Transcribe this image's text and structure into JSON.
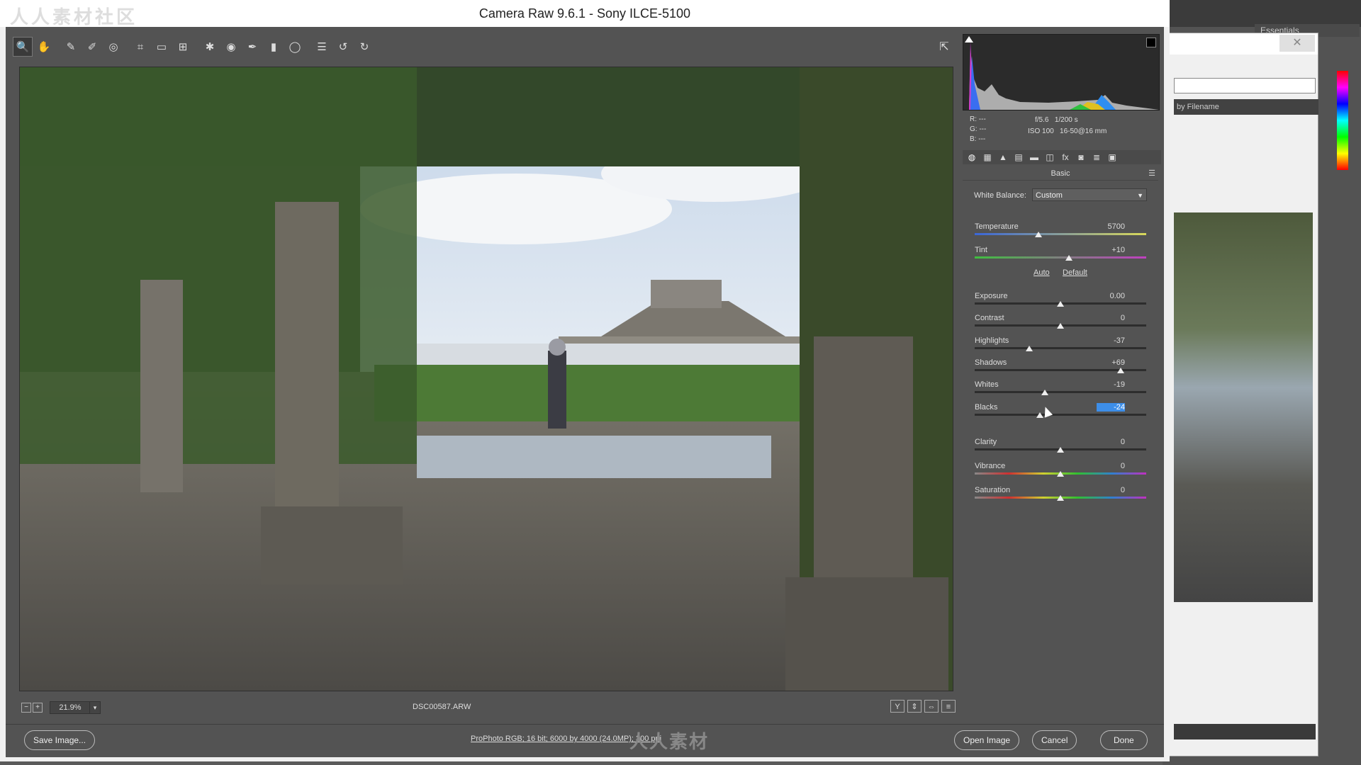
{
  "app": {
    "title": "Camera Raw 9.6.1  -  Sony ILCE-5100"
  },
  "background_app": {
    "workspace": "Essentials",
    "sort_label": "by Filename",
    "close_glyph": "✕"
  },
  "toolbar": {
    "tools": [
      {
        "name": "zoom-tool-icon",
        "glyph": "🔍",
        "active": true
      },
      {
        "name": "hand-tool-icon",
        "glyph": "✋",
        "active": false
      },
      {
        "name": "white-balance-tool-icon",
        "glyph": "✎",
        "active": false
      },
      {
        "name": "color-sampler-tool-icon",
        "glyph": "✐",
        "active": false
      },
      {
        "name": "targeted-adjustment-tool-icon",
        "glyph": "◎",
        "active": false
      },
      {
        "name": "crop-tool-icon",
        "glyph": "⌗",
        "active": false
      },
      {
        "name": "straighten-tool-icon",
        "glyph": "▭",
        "active": false
      },
      {
        "name": "transform-tool-icon",
        "glyph": "⊞",
        "active": false
      },
      {
        "name": "spot-removal-tool-icon",
        "glyph": "✱",
        "active": false
      },
      {
        "name": "red-eye-tool-icon",
        "glyph": "◉",
        "active": false
      },
      {
        "name": "adjustment-brush-icon",
        "glyph": "✒",
        "active": false
      },
      {
        "name": "graduated-filter-icon",
        "glyph": "▮",
        "active": false
      },
      {
        "name": "radial-filter-icon",
        "glyph": "◯",
        "active": false
      },
      {
        "name": "preferences-icon",
        "glyph": "☰",
        "active": false
      },
      {
        "name": "rotate-left-icon",
        "glyph": "↺",
        "active": false
      },
      {
        "name": "rotate-right-icon",
        "glyph": "↻",
        "active": false
      }
    ],
    "fullscreen_glyph": "⇱"
  },
  "status": {
    "zoom": "21.9%",
    "zoom_minus": "−",
    "zoom_plus": "+",
    "filename": "DSC00587.ARW",
    "view_buttons": [
      "Y",
      "⇕",
      "⇔",
      "≡"
    ]
  },
  "bottom": {
    "save_label": "Save Image...",
    "workflow_text": "ProPhoto RGB; 16 bit; 6000 by 4000 (24.0MP); 300 ppi",
    "watermark": "人人素材",
    "open_label": "Open Image",
    "cancel_label": "Cancel",
    "done_label": "Done"
  },
  "histogram": {
    "r_label": "R:",
    "g_label": "G:",
    "b_label": "B:",
    "r_val": "---",
    "g_val": "---",
    "b_val": "---",
    "aperture": "f/5.6",
    "shutter": "1/200 s",
    "iso": "ISO 100",
    "lens": "16-50@16 mm"
  },
  "panel": {
    "tabs": [
      "◍",
      "▦",
      "▲",
      "▤",
      "▬",
      "◫",
      "fx",
      "◙",
      "≣",
      "▣"
    ],
    "title": "Basic",
    "wb_label": "White Balance:",
    "wb_value": "Custom",
    "auto_label": "Auto",
    "default_label": "Default",
    "sliders": [
      {
        "label": "Temperature",
        "value": "5700",
        "pos": 0.37,
        "track": "temp"
      },
      {
        "label": "Tint",
        "value": "+10",
        "pos": 0.55,
        "track": "tint"
      },
      {
        "label": "Exposure",
        "value": "0.00",
        "pos": 0.5,
        "track": "plain"
      },
      {
        "label": "Contrast",
        "value": "0",
        "pos": 0.5,
        "track": "plain"
      },
      {
        "label": "Highlights",
        "value": "-37",
        "pos": 0.32,
        "track": "plain"
      },
      {
        "label": "Shadows",
        "value": "+69",
        "pos": 0.85,
        "track": "plain"
      },
      {
        "label": "Whites",
        "value": "-19",
        "pos": 0.41,
        "track": "plain"
      },
      {
        "label": "Blacks",
        "value": "-24",
        "pos": 0.38,
        "track": "plain",
        "selected": true
      },
      {
        "label": "Clarity",
        "value": "0",
        "pos": 0.5,
        "track": "plain"
      },
      {
        "label": "Vibrance",
        "value": "0",
        "pos": 0.5,
        "track": "vib"
      },
      {
        "label": "Saturation",
        "value": "0",
        "pos": 0.5,
        "track": "sat"
      }
    ]
  },
  "colors": {
    "panel_bg": "#535353",
    "selection": "#3d8ee8"
  }
}
